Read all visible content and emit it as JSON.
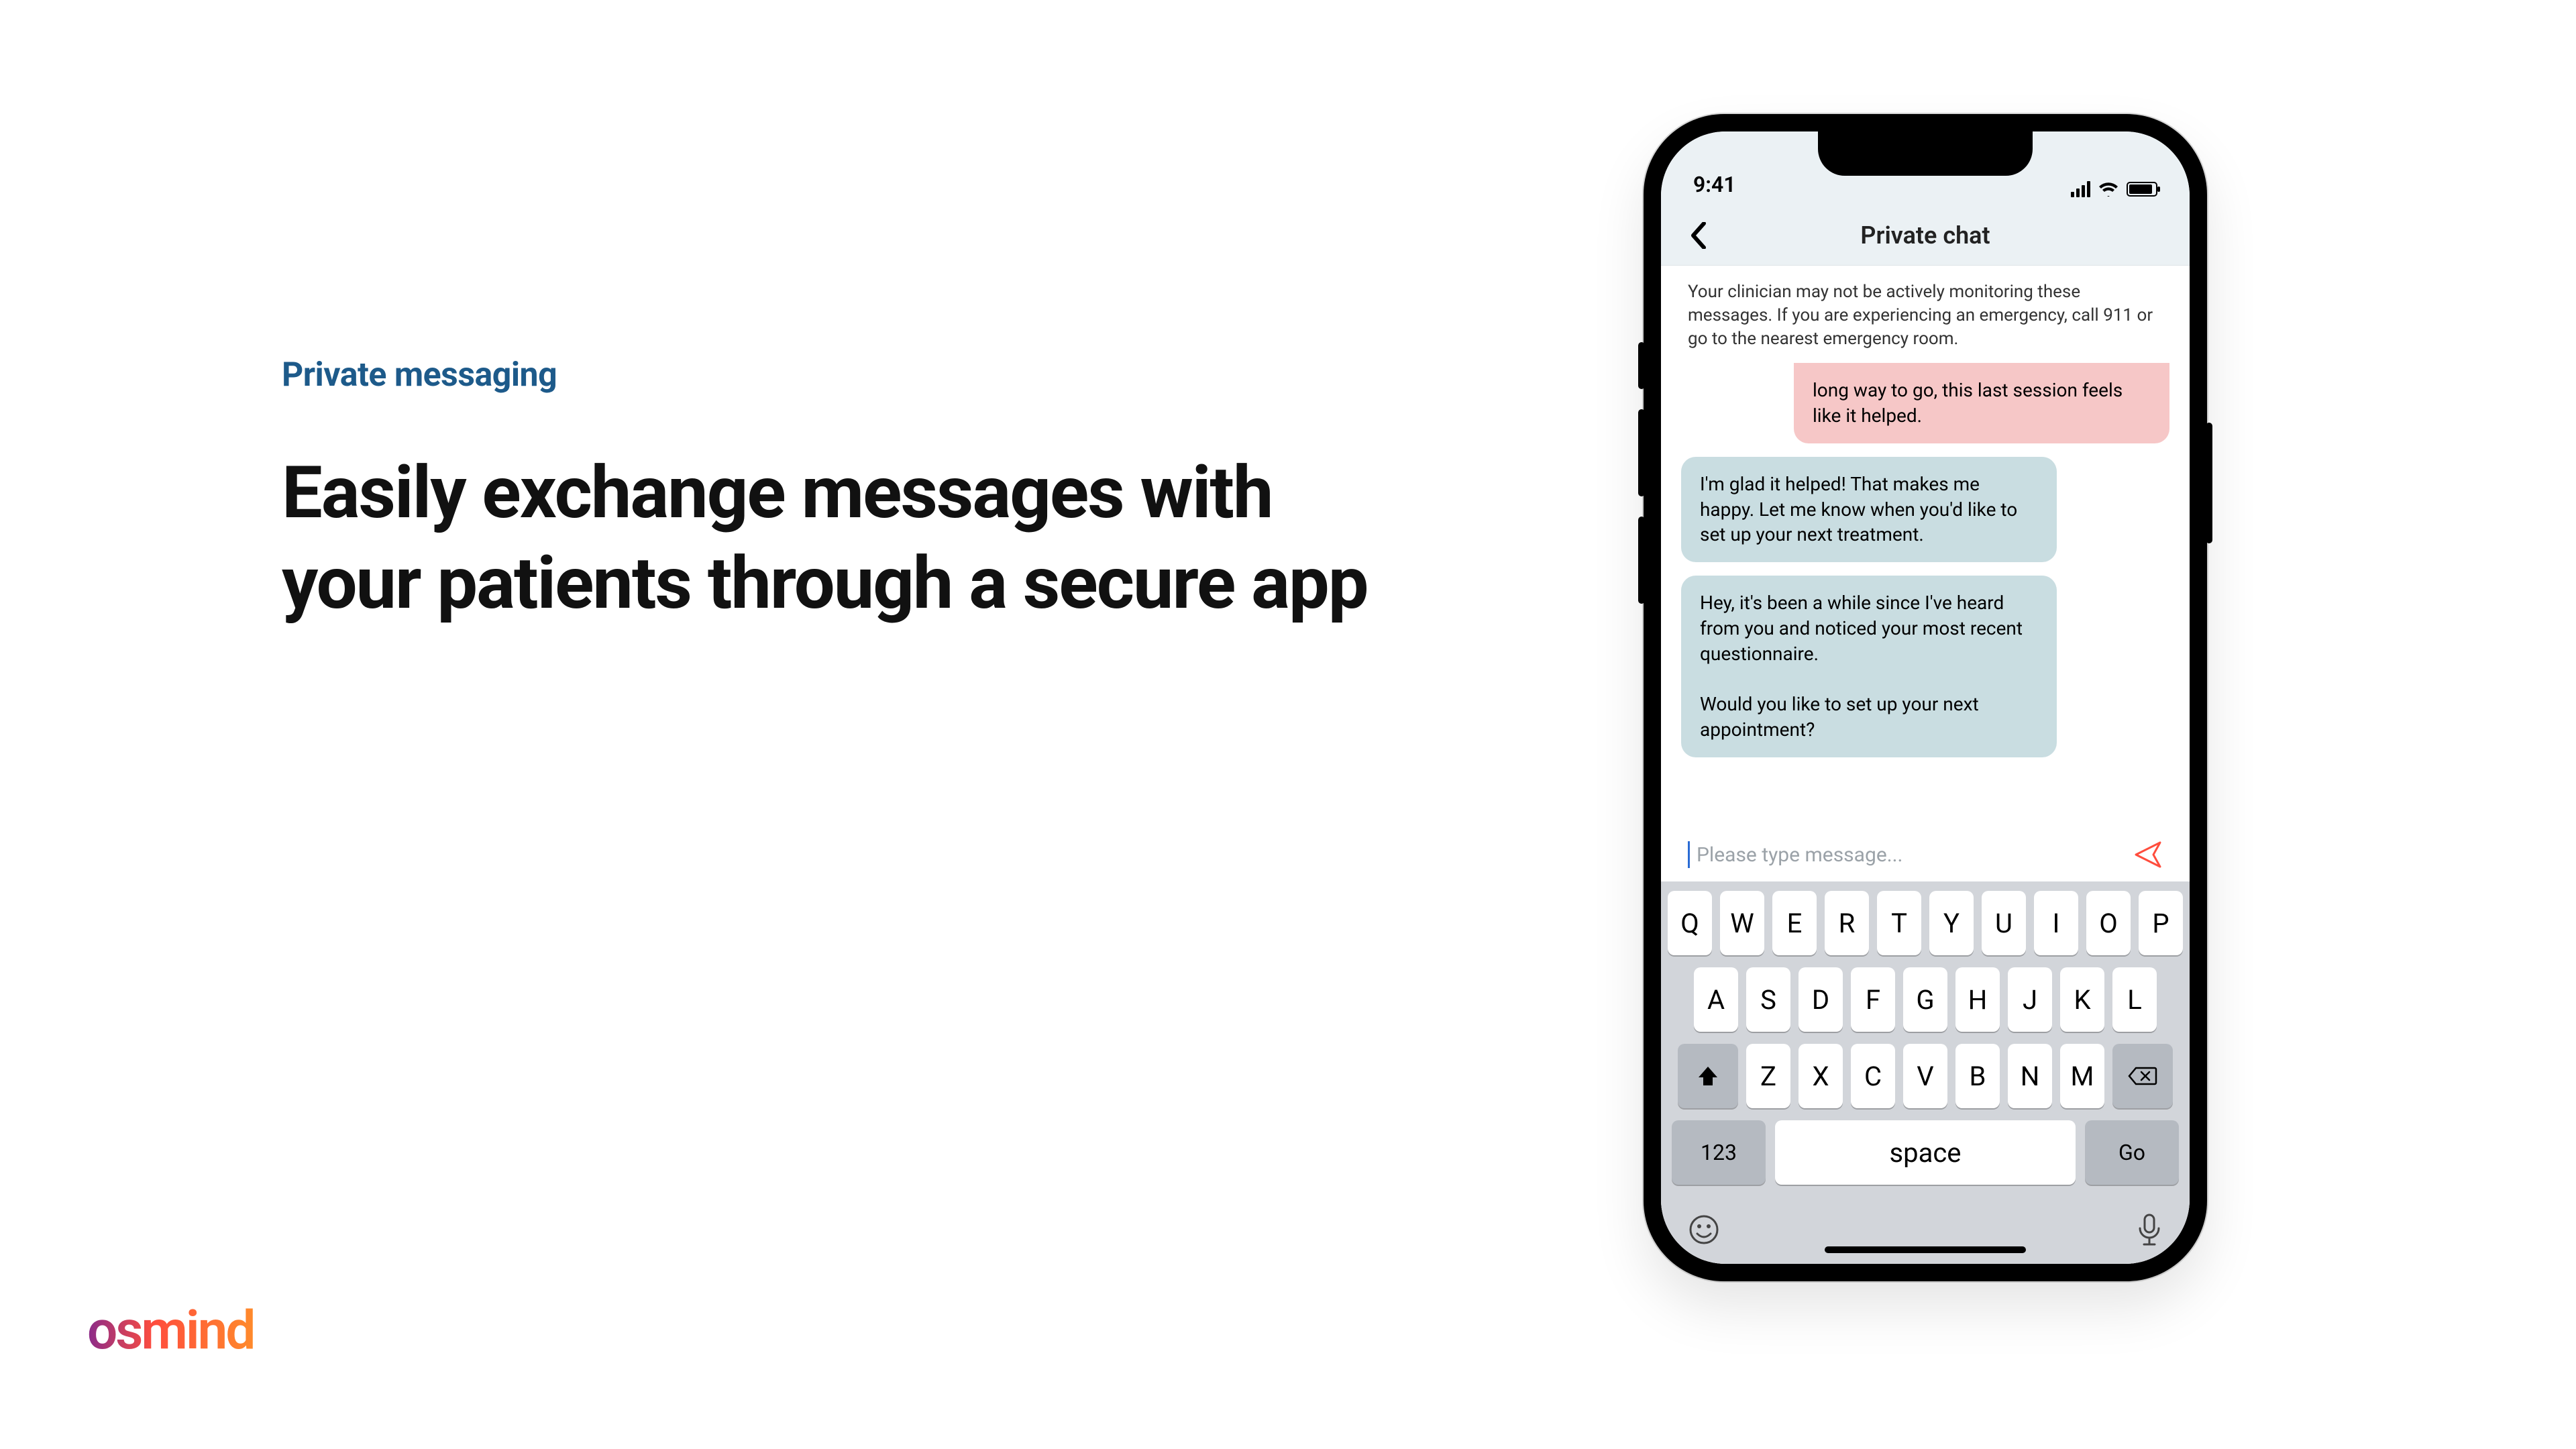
{
  "marketing": {
    "eyebrow": "Private messaging",
    "headline": "Easily exchange messages with your patients through a secure app",
    "logo": "osmind"
  },
  "status": {
    "time": "9:41"
  },
  "nav": {
    "title": "Private chat"
  },
  "chat": {
    "disclaimer": "Your clinician may not be actively monitoring these messages. If you are experiencing an emergency, call 911 or go to the nearest emergency room.",
    "messages": [
      {
        "side": "sent",
        "text": "long way to go, this last session feels like it helped."
      },
      {
        "side": "recv",
        "text": "I'm glad it helped! That makes me happy. Let me know when you'd like to set up your next treatment."
      },
      {
        "side": "recv",
        "text": "Hey, it's been a while since I've heard from you and noticed your most recent questionnaire.\n\nWould you like to set up your next appointment?"
      }
    ],
    "compose_placeholder": "Please type message..."
  },
  "keyboard": {
    "row1": [
      "Q",
      "W",
      "E",
      "R",
      "T",
      "Y",
      "U",
      "I",
      "O",
      "P"
    ],
    "row2": [
      "A",
      "S",
      "D",
      "F",
      "G",
      "H",
      "J",
      "K",
      "L"
    ],
    "row3": [
      "Z",
      "X",
      "C",
      "V",
      "B",
      "N",
      "M"
    ],
    "num_label": "123",
    "space_label": "space",
    "go_label": "Go"
  }
}
